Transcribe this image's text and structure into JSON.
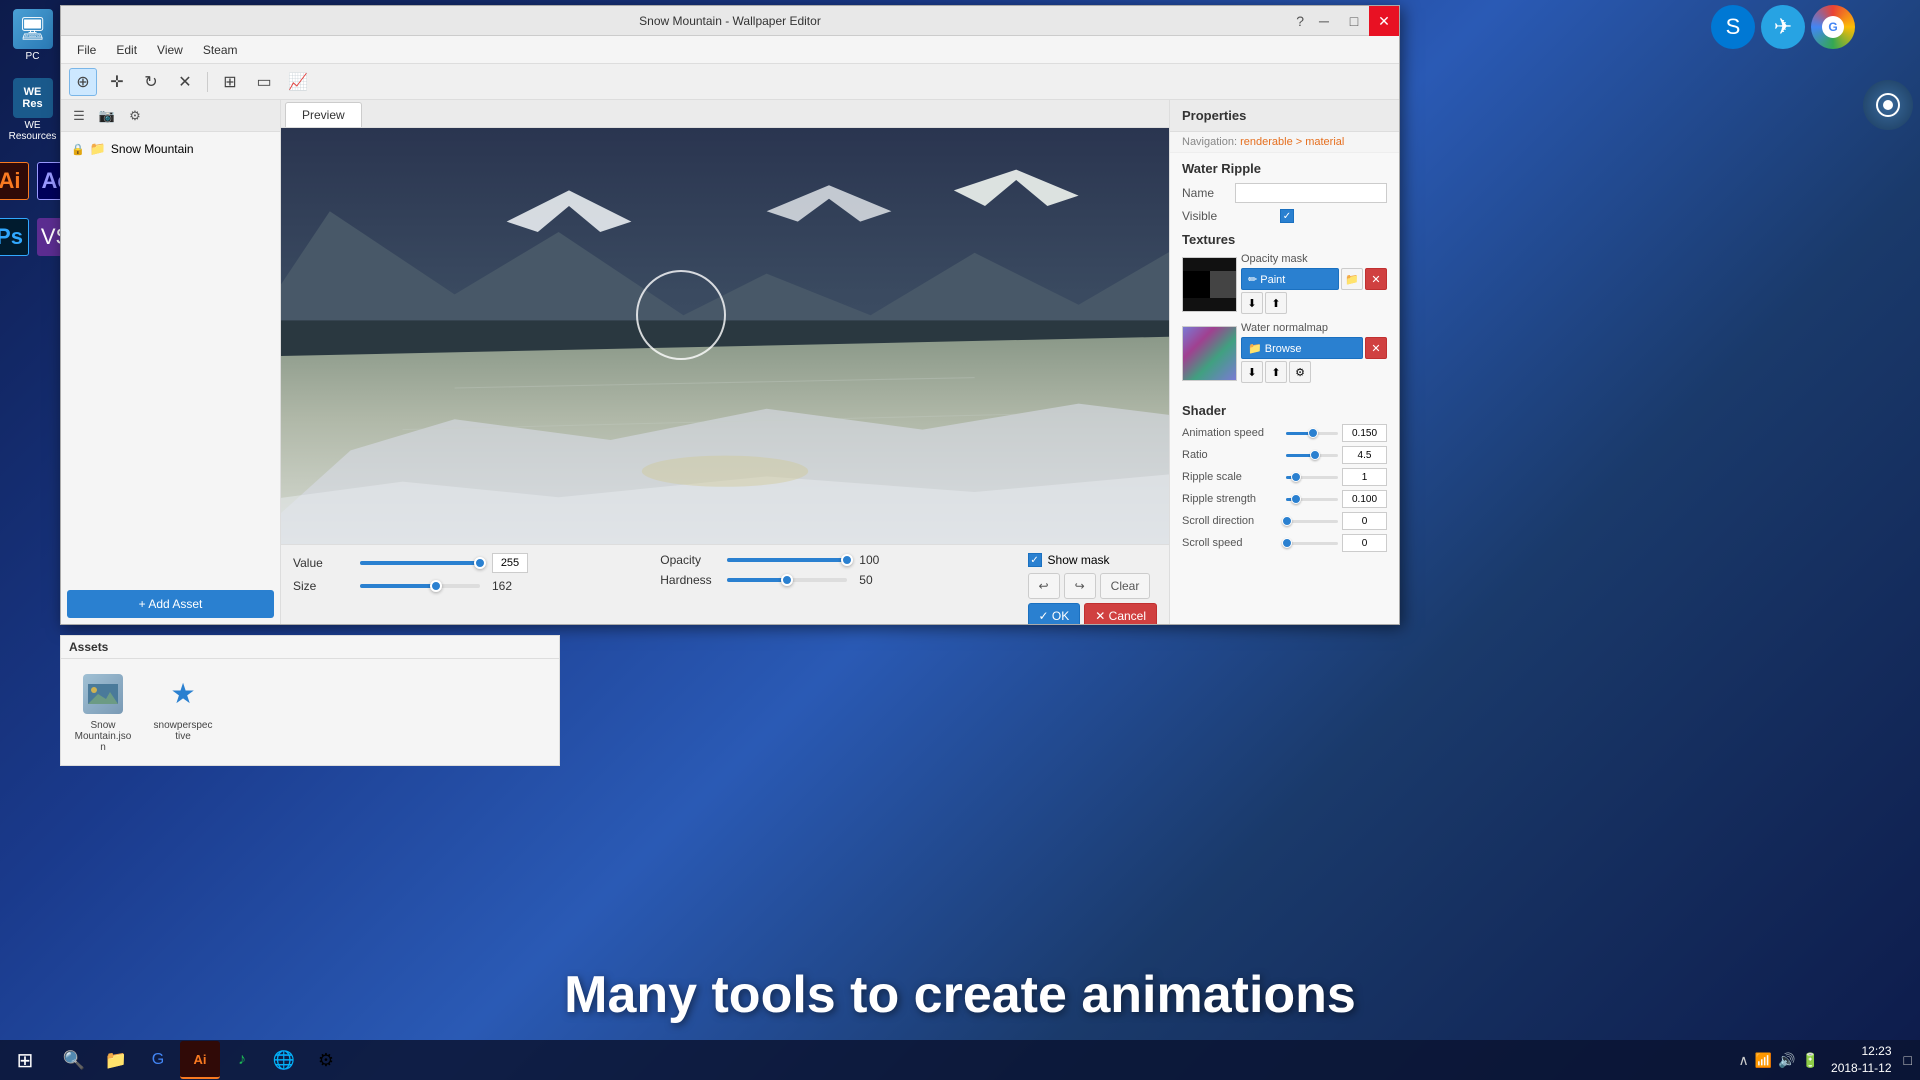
{
  "desktop": {
    "icons_left": [
      {
        "name": "PC",
        "label": "PC",
        "type": "pc"
      },
      {
        "name": "WE Resources",
        "label": "WE\nResources",
        "type": "we"
      },
      {
        "name": "Adobe Illustrator",
        "label": "Ai",
        "type": "ai"
      },
      {
        "name": "Adobe After Effects",
        "label": "Ae",
        "type": "ae"
      },
      {
        "name": "Adobe Photoshop",
        "label": "Ps",
        "type": "ps"
      },
      {
        "name": "Visual Studio Code",
        "label": "VS",
        "type": "vs"
      }
    ]
  },
  "window": {
    "title": "Snow Mountain - Wallpaper Editor",
    "menu": [
      "File",
      "Edit",
      "View",
      "Steam"
    ],
    "controls": [
      "?",
      "─",
      "□",
      "✕"
    ]
  },
  "toolbar": {
    "tools": [
      "⊕",
      "✛",
      "↻",
      "✕",
      "⊞",
      "▭",
      "📈"
    ]
  },
  "left_panel": {
    "scene_name": "Snow Mountain",
    "add_asset_label": "+ Add Asset"
  },
  "preview": {
    "tab_label": "Preview"
  },
  "brush_controls": {
    "value_label": "Value",
    "value": "255",
    "size_label": "Size",
    "size": "162",
    "opacity_label": "Opacity",
    "opacity": "100",
    "hardness_label": "Hardness",
    "hardness": "50",
    "show_mask_label": "Show mask",
    "undo_label": "↩",
    "redo_label": "↪",
    "clear_label": "Clear",
    "ok_label": "✓ OK",
    "cancel_label": "✕ Cancel"
  },
  "properties": {
    "header": "Properties",
    "nav_path": "Navigation: renderable > material",
    "section_title": "Water Ripple",
    "name_label": "Name",
    "name_value": "",
    "visible_label": "Visible"
  },
  "textures": {
    "header": "Textures",
    "opacity_mask_label": "Opacity mask",
    "paint_label": "✏ Paint",
    "water_normalmap_label": "Water normalmap",
    "browse_label": "📁 Browse"
  },
  "shader": {
    "header": "Shader",
    "params": [
      {
        "label": "Animation speed",
        "value": "0.150",
        "percent": 52
      },
      {
        "label": "Ratio",
        "value": "4.5",
        "percent": 55
      },
      {
        "label": "Ripple scale",
        "value": "1",
        "percent": 20
      },
      {
        "label": "Ripple strength",
        "value": "0.100",
        "percent": 20
      },
      {
        "label": "Scroll direction",
        "value": "0",
        "percent": 0
      },
      {
        "label": "Scroll speed",
        "value": "0",
        "percent": 0
      }
    ]
  },
  "assets": {
    "header": "Assets",
    "items": [
      {
        "name": "Snow Mountain.json",
        "type": "image"
      },
      {
        "name": "snowperspective",
        "type": "star"
      }
    ]
  },
  "taskbar": {
    "clock_time": "12:23",
    "clock_date": "2018-11-12"
  },
  "caption": {
    "text": "Many tools to create animations"
  }
}
